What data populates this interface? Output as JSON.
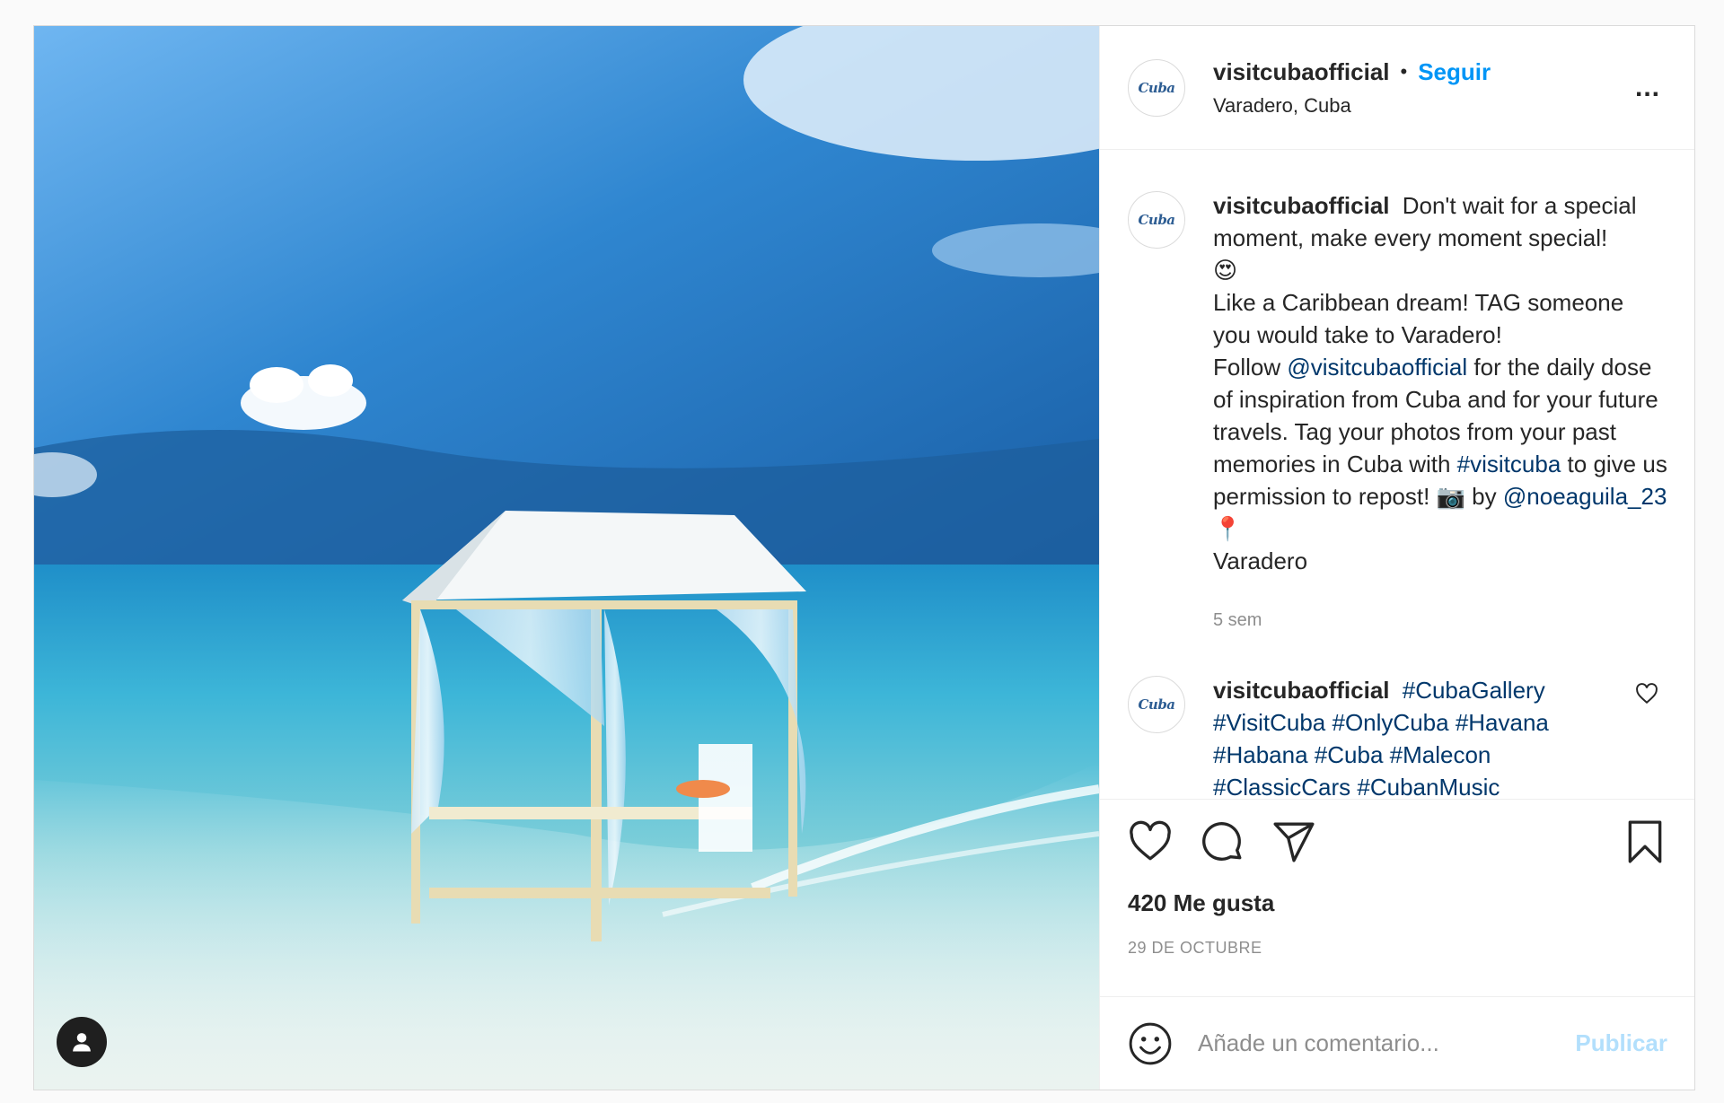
{
  "post": {
    "username": "visitcubaofficial",
    "separator": "•",
    "follow_label": "Seguir",
    "location": "Varadero, Cuba",
    "more_label": "...",
    "avatar_logo": "Cuba"
  },
  "caption": {
    "username": "visitcubaofficial",
    "text1": "Don't wait for a special moment, make every moment special!",
    "emoji1": "😍",
    "text2": "Like a Caribbean dream! TAG someone you would take to Varadero!",
    "text3a": "Follow",
    "mention1": "@visitcubaofficial",
    "text3b": "for the daily dose of inspiration from Cuba and for your future travels. Tag your photos from your past memories in Cuba with",
    "hashtag1": "#visitcuba",
    "text3c": "to give us permission to repost!",
    "emoji2": "📷",
    "text3d": "by",
    "mention2": "@noeaguila_23",
    "emoji3": "📍",
    "text4": "Varadero",
    "time": "5 sem"
  },
  "comment2": {
    "username": "visitcubaofficial",
    "hashtags": [
      "#CubaGallery",
      "#VisitCuba",
      "#OnlyCuba",
      "#Havana",
      "#Habana",
      "#Cuba",
      "#Malecon",
      "#ClassicCars",
      "#CubanMusic"
    ]
  },
  "stats": {
    "likes": "420 Me gusta",
    "date": "29 DE OCTUBRE"
  },
  "composer": {
    "placeholder": "Añade un comentario...",
    "publish_label": "Publicar"
  },
  "icons": {
    "tag": "user-tag-icon",
    "like": "heart-icon",
    "comment": "comment-icon",
    "share": "paper-plane-icon",
    "save": "bookmark-icon",
    "emoji": "emoji-icon",
    "more": "more-options-icon"
  },
  "colors": {
    "link": "#00376b",
    "follow": "#0095f6",
    "publish_disabled": "#b2dffc",
    "muted": "#8e8e8e"
  }
}
